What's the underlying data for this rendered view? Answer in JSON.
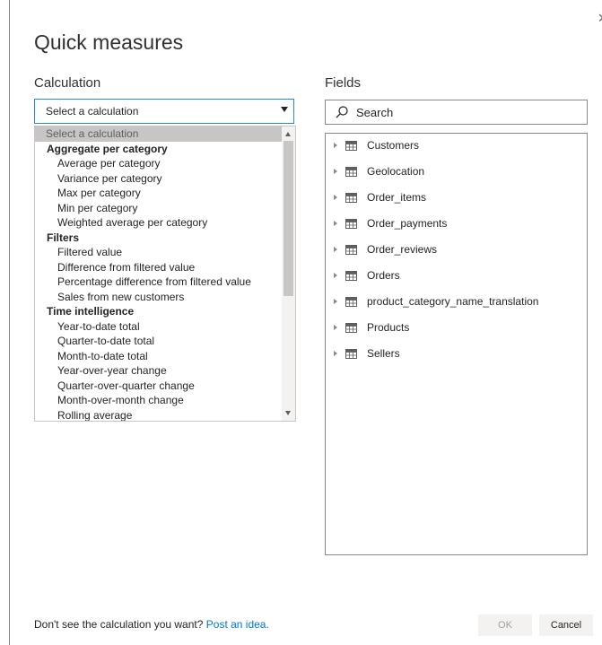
{
  "dialog": {
    "title": "Quick measures",
    "close": "×"
  },
  "calculation": {
    "label": "Calculation",
    "selected": "Select a calculation",
    "options": [
      {
        "type": "placeholder",
        "label": "Select a calculation"
      },
      {
        "type": "group",
        "label": "Aggregate per category"
      },
      {
        "type": "item",
        "label": "Average per category"
      },
      {
        "type": "item",
        "label": "Variance per category"
      },
      {
        "type": "item",
        "label": "Max per category"
      },
      {
        "type": "item",
        "label": "Min per category"
      },
      {
        "type": "item",
        "label": "Weighted average per category"
      },
      {
        "type": "group",
        "label": "Filters"
      },
      {
        "type": "item",
        "label": "Filtered value"
      },
      {
        "type": "item",
        "label": "Difference from filtered value"
      },
      {
        "type": "item",
        "label": "Percentage difference from filtered value"
      },
      {
        "type": "item",
        "label": "Sales from new customers"
      },
      {
        "type": "group",
        "label": "Time intelligence"
      },
      {
        "type": "item",
        "label": "Year-to-date total"
      },
      {
        "type": "item",
        "label": "Quarter-to-date total"
      },
      {
        "type": "item",
        "label": "Month-to-date total"
      },
      {
        "type": "item",
        "label": "Year-over-year change"
      },
      {
        "type": "item",
        "label": "Quarter-over-quarter change"
      },
      {
        "type": "item",
        "label": "Month-over-month change"
      },
      {
        "type": "item",
        "label": "Rolling average"
      }
    ]
  },
  "fields": {
    "label": "Fields",
    "search_placeholder": "Search",
    "tables": [
      "Customers",
      "Geolocation",
      "Order_items",
      "Order_payments",
      "Order_reviews",
      "Orders",
      "product_category_name_translation",
      "Products",
      "Sellers"
    ]
  },
  "footer": {
    "prompt": "Don't see the calculation you want?",
    "link": "Post an idea.",
    "ok": "OK",
    "cancel": "Cancel"
  }
}
